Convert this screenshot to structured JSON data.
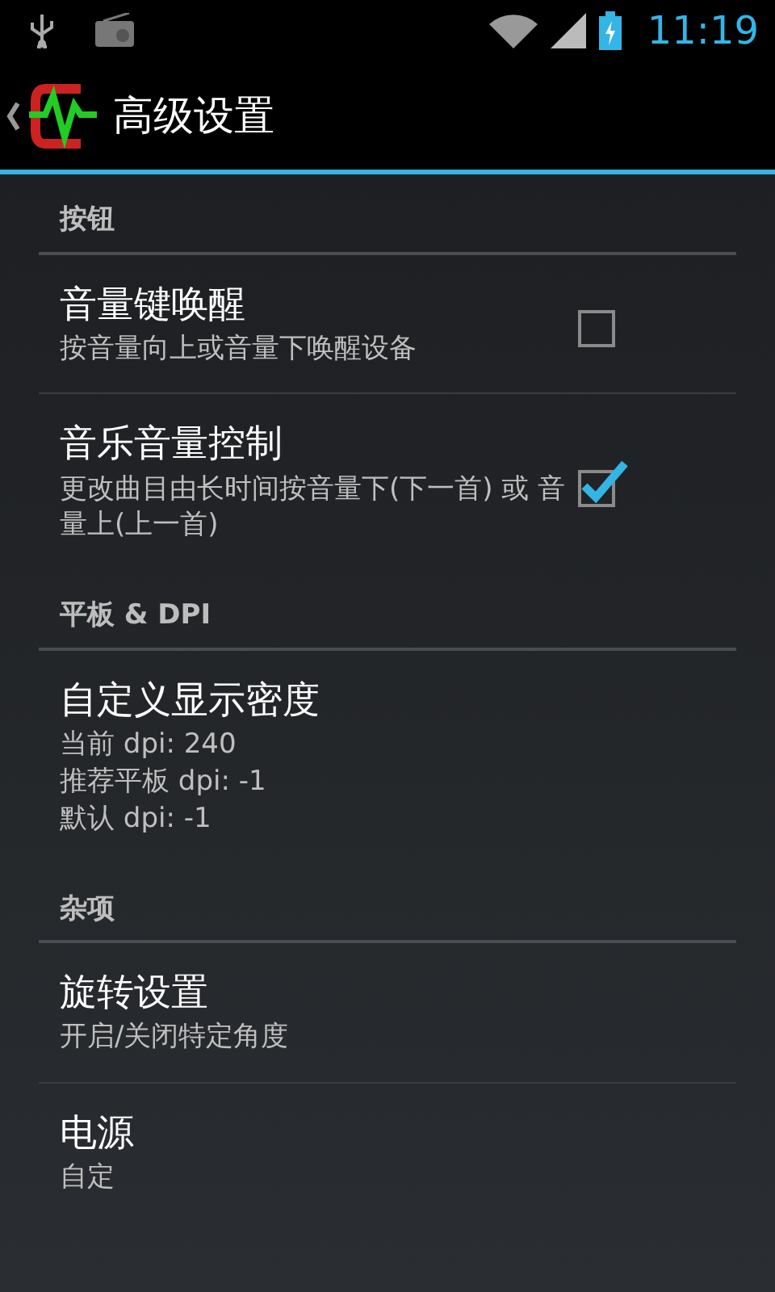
{
  "status_bar": {
    "time": "11:19"
  },
  "action_bar": {
    "title": "高级设置"
  },
  "sections": [
    {
      "header": "按钮",
      "items": [
        {
          "kind": "checkbox",
          "title": "音量键唤醒",
          "summary": [
            "按音量向上或音量下唤醒设备"
          ],
          "checked": false
        },
        {
          "kind": "checkbox",
          "title": "音乐音量控制",
          "summary": [
            "更改曲目由长时间按音量下(下一首) 或 音量上(上一首)"
          ],
          "checked": true
        }
      ]
    },
    {
      "header": "平板 & DPI",
      "items": [
        {
          "kind": "plain",
          "title": "自定义显示密度",
          "summary": [
            "当前 dpi: 240",
            "推荐平板 dpi: -1",
            "默认 dpi: -1"
          ]
        }
      ]
    },
    {
      "header": "杂项",
      "items": [
        {
          "kind": "plain",
          "title": "旋转设置",
          "summary": [
            "开启/关闭特定角度"
          ]
        },
        {
          "kind": "plain",
          "title": "电源",
          "summary": [
            "自定"
          ]
        }
      ]
    }
  ]
}
